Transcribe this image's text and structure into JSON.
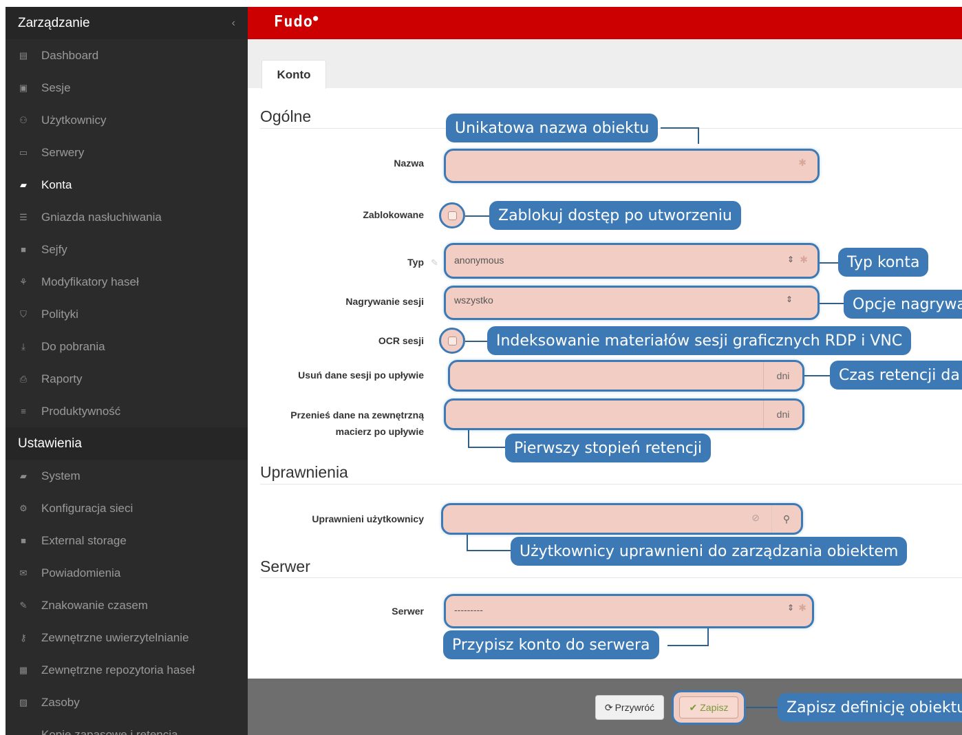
{
  "sidebar": {
    "header": "Zarządzanie",
    "collapse_glyph": "‹",
    "items": [
      {
        "label": "Dashboard",
        "icon": "chart-icon"
      },
      {
        "label": "Sesje",
        "icon": "film-icon"
      },
      {
        "label": "Użytkownicy",
        "icon": "users-icon"
      },
      {
        "label": "Serwery",
        "icon": "server-icon"
      },
      {
        "label": "Konta",
        "icon": "book-icon",
        "active": true
      },
      {
        "label": "Gniazda nasłuchiwania",
        "icon": "rss-icon"
      },
      {
        "label": "Sejfy",
        "icon": "safe-icon"
      },
      {
        "label": "Modyfikatory haseł",
        "icon": "sitemap-icon"
      },
      {
        "label": "Polityki",
        "icon": "shield-icon"
      },
      {
        "label": "Do pobrania",
        "icon": "download-icon"
      },
      {
        "label": "Raporty",
        "icon": "print-icon"
      },
      {
        "label": "Produktywność",
        "icon": "list-icon"
      }
    ],
    "section2": "Ustawienia",
    "items2": [
      {
        "label": "System",
        "icon": "folder-open-icon"
      },
      {
        "label": "Konfiguracja sieci",
        "icon": "cogs-icon"
      },
      {
        "label": "External storage",
        "icon": "folder-icon"
      },
      {
        "label": "Powiadomienia",
        "icon": "envelope-icon"
      },
      {
        "label": "Znakowanie czasem",
        "icon": "edit-icon"
      },
      {
        "label": "Zewnętrzne uwierzytelnianie",
        "icon": "key-icon"
      },
      {
        "label": "Zewnętrzne repozytoria haseł",
        "icon": "grid-icon"
      },
      {
        "label": "Zasoby",
        "icon": "image-icon"
      },
      {
        "label": "Kopie zapasowe i retencja",
        "icon": "hdd-icon"
      }
    ]
  },
  "topbar": {
    "logo": "Fudo",
    "brand_color": "#cc0000"
  },
  "tabs": [
    {
      "label": "Konto"
    }
  ],
  "sections": {
    "general": "Ogólne",
    "permissions": "Uprawnienia",
    "server": "Serwer"
  },
  "form": {
    "name": {
      "label": "Nazwa",
      "value": ""
    },
    "blocked": {
      "label": "Zablokowane",
      "checked": false
    },
    "type": {
      "label": "Typ",
      "value": "anonymous"
    },
    "recording": {
      "label": "Nagrywanie sesji",
      "value": "wszystko"
    },
    "ocr": {
      "label": "OCR sesji",
      "checked": false
    },
    "delete_after": {
      "label": "Usuń dane sesji po upływie",
      "unit": "dni"
    },
    "move_after": {
      "label_line1": "Przenieś dane na zewnętrzną",
      "label_line2": "macierz po upływie",
      "unit": "dni"
    },
    "users": {
      "label": "Uprawnieni użytkownicy"
    },
    "server": {
      "label": "Serwer",
      "value": "---------"
    }
  },
  "callouts": {
    "name": "Unikatowa nazwa obiektu",
    "blocked": "Zablokuj dostęp po utworzeniu",
    "type": "Typ konta",
    "recording": "Opcje nagrywa",
    "ocr": "Indeksowanie materiałów sesji graficznych RDP i VNC",
    "delete": "Czas retencji da",
    "move": "Pierwszy stopień retencji",
    "users": "Użytkownicy uprawnieni do zarządzania obiektem",
    "server": "Przypisz konto do serwera",
    "save": "Zapisz definicję obiektu"
  },
  "footer": {
    "restore_label": "Przywróć",
    "save_label": "Zapisz"
  },
  "colors": {
    "callout": "#3d7ab5",
    "field_highlight": "#f2cdc4",
    "sidebar": "#2b2b2b"
  }
}
